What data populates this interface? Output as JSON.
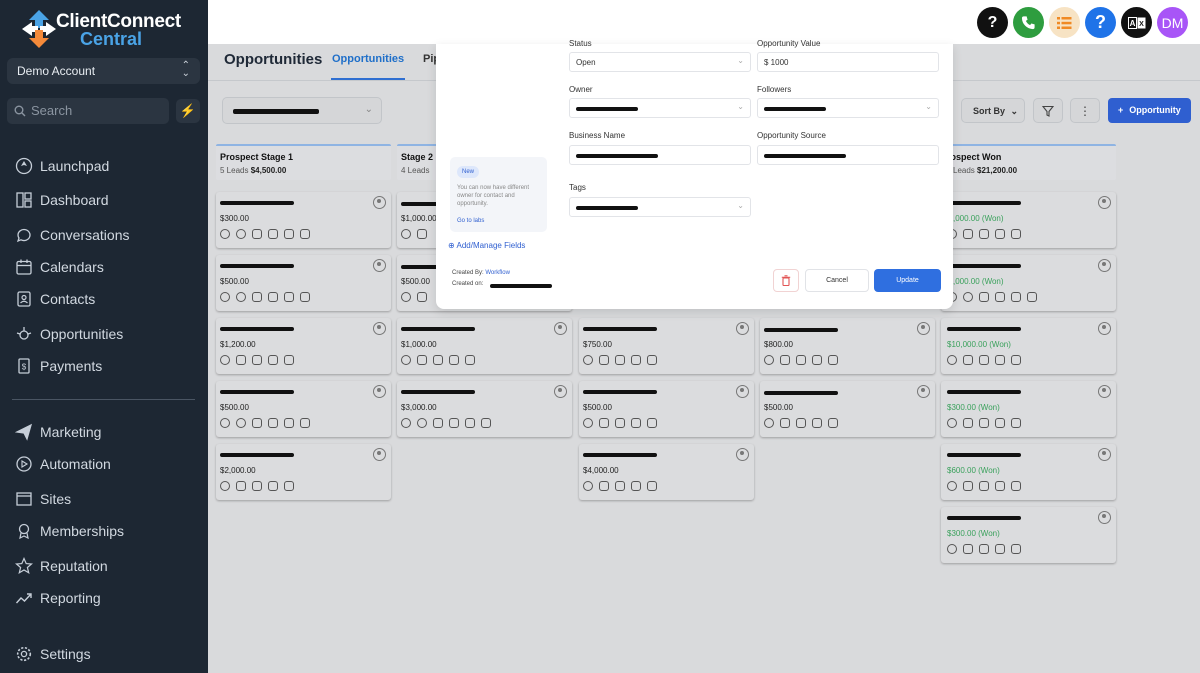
{
  "app": {
    "logo_line1": "ClientConnect",
    "logo_line2": "Central",
    "account": "Demo Account",
    "search_placeholder": "Search"
  },
  "nav": {
    "items": [
      {
        "label": "Launchpad",
        "icon": "launchpad-icon"
      },
      {
        "label": "Dashboard",
        "icon": "dashboard-icon"
      },
      {
        "label": "Conversations",
        "icon": "chat-icon"
      },
      {
        "label": "Calendars",
        "icon": "calendar-icon"
      },
      {
        "label": "Contacts",
        "icon": "contacts-icon"
      },
      {
        "label": "Opportunities",
        "icon": "opportunities-icon"
      },
      {
        "label": "Payments",
        "icon": "payments-icon"
      },
      {
        "label": "Marketing",
        "icon": "send-icon"
      },
      {
        "label": "Automation",
        "icon": "automation-icon"
      },
      {
        "label": "Sites",
        "icon": "sites-icon"
      },
      {
        "label": "Memberships",
        "icon": "memberships-icon"
      },
      {
        "label": "Reputation",
        "icon": "star-icon"
      },
      {
        "label": "Reporting",
        "icon": "reporting-icon"
      },
      {
        "label": "Settings",
        "icon": "gear-icon"
      }
    ]
  },
  "topbar": {
    "avatar_initials": "DM",
    "colors": {
      "black": "#111111",
      "green": "#2e9d3f",
      "list": "#f7e3c4",
      "blue": "#1f73e8",
      "dark": "#111111",
      "avatar": "#a855f7"
    }
  },
  "header": {
    "title": "Opportunities",
    "tab_active": "Opportunities",
    "tab_partial": "Pip",
    "sort_label": "Sort By",
    "add_label": "Opportunity"
  },
  "columns": [
    {
      "name": "Prospect Stage 1",
      "leads": "5 Leads",
      "amount": "$4,500.00",
      "cards": [
        "$300.00",
        "$500.00",
        "$1,200.00",
        "$500.00",
        "$2,000.00"
      ]
    },
    {
      "name": "Stage 2",
      "leads": "4 Leads",
      "amount": "",
      "cards": [
        "$1,000.00",
        "$500.00",
        "$1,000.00",
        "$3,000.00"
      ]
    },
    {
      "name": "",
      "leads": "",
      "amount": "",
      "cards": [
        "$750.00",
        "$500.00",
        "$4,000.00"
      ]
    },
    {
      "name": "",
      "leads": "",
      "amount": "",
      "cards": [
        "$800.00",
        "$500.00"
      ]
    },
    {
      "name": "rospect Won",
      "leads": "Leads",
      "amount": "$21,200.00",
      "cards": [
        ",000.00 (Won)",
        ",000.00 (Won)",
        "$10,000.00 (Won)",
        "$300.00 (Won)",
        "$600.00 (Won)",
        "$300.00 (Won)"
      ]
    }
  ],
  "modal": {
    "status_label": "Status",
    "status_value": "Open",
    "value_label": "Opportunity Value",
    "value_value": "$ 1000",
    "owner_label": "Owner",
    "followers_label": "Followers",
    "business_label": "Business Name",
    "source_label": "Opportunity Source",
    "tags_label": "Tags",
    "labs_badge": "New",
    "labs_desc": "You can now have different owner for contact and opportunity.",
    "labs_link": "Go to labs",
    "add_fields": "Add/Manage Fields",
    "created_by_label": "Created By:",
    "created_by_value": "Workflow",
    "created_on_label": "Created on:",
    "cancel": "Cancel",
    "update": "Update"
  }
}
